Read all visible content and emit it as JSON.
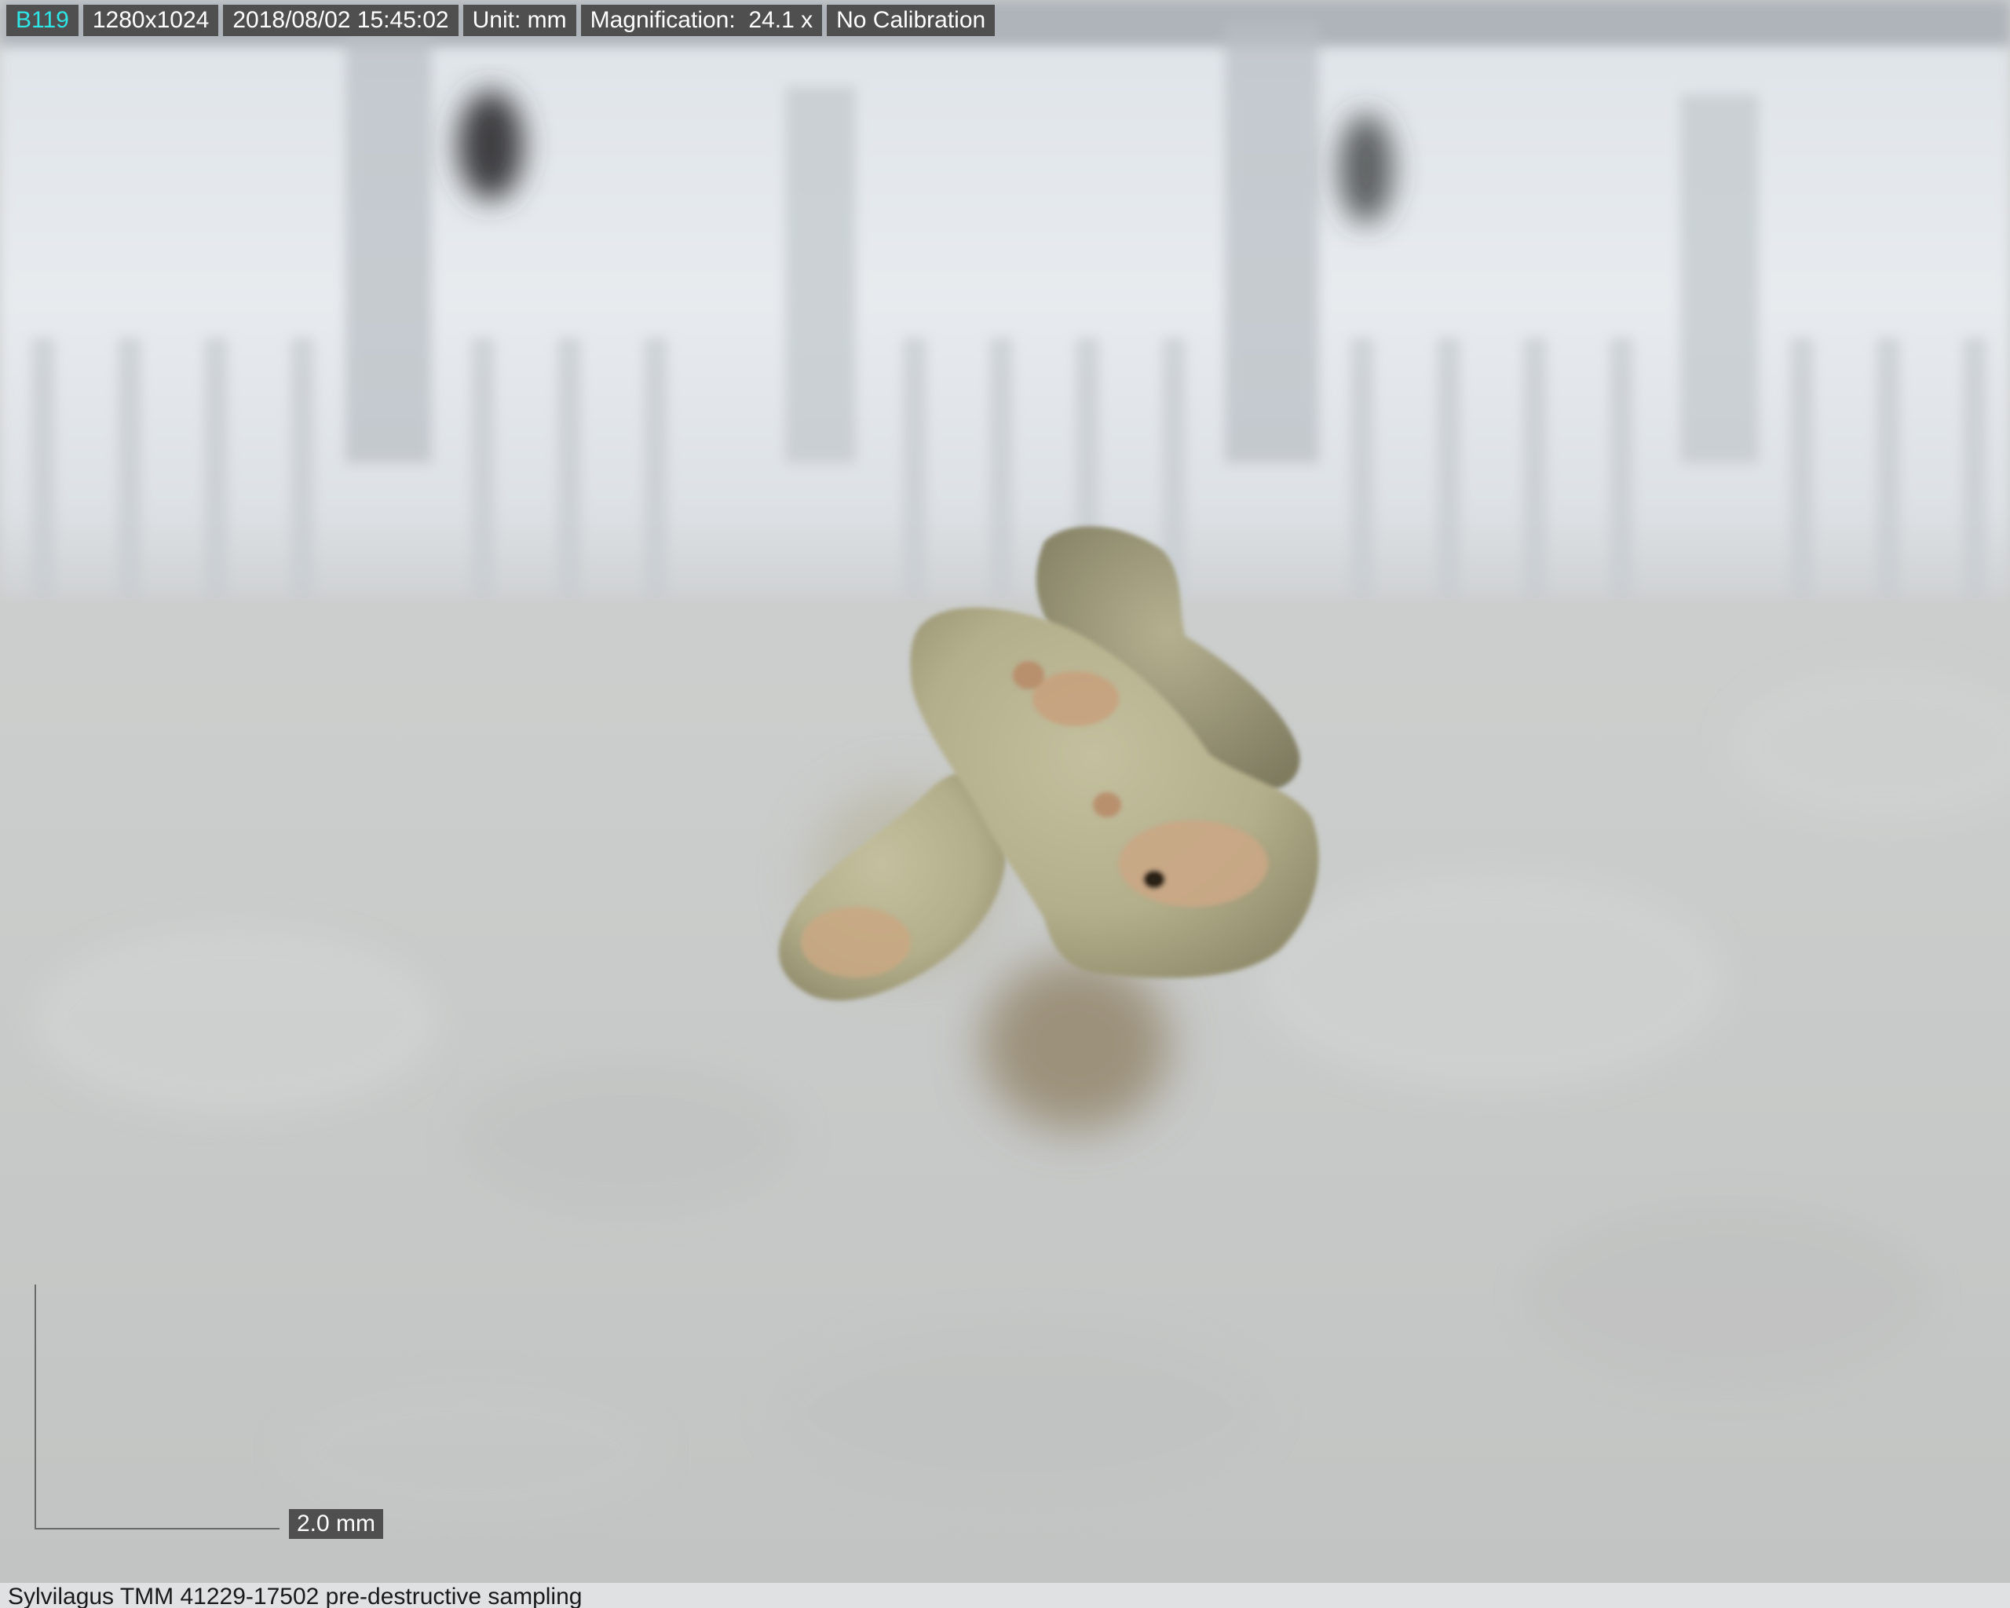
{
  "info_bar": {
    "image_id": "B119",
    "resolution": "1280x1024",
    "datetime": "2018/08/02 15:45:02",
    "unit": "Unit: mm",
    "magnification": "Magnification:  24.1 x",
    "calibration": "No Calibration"
  },
  "scale_bar": {
    "label": "2.0 mm"
  },
  "caption": {
    "text": "Sylvilagus TMM 41229-17502 pre-destructive sampling"
  },
  "colors": {
    "info_bg": "#4f4f4f",
    "info_id_text": "#2ee6e6",
    "info_text": "#ffffff",
    "background": "#c9cbcb",
    "ruler": "#e6ebef",
    "specimen": "#b7b290"
  }
}
